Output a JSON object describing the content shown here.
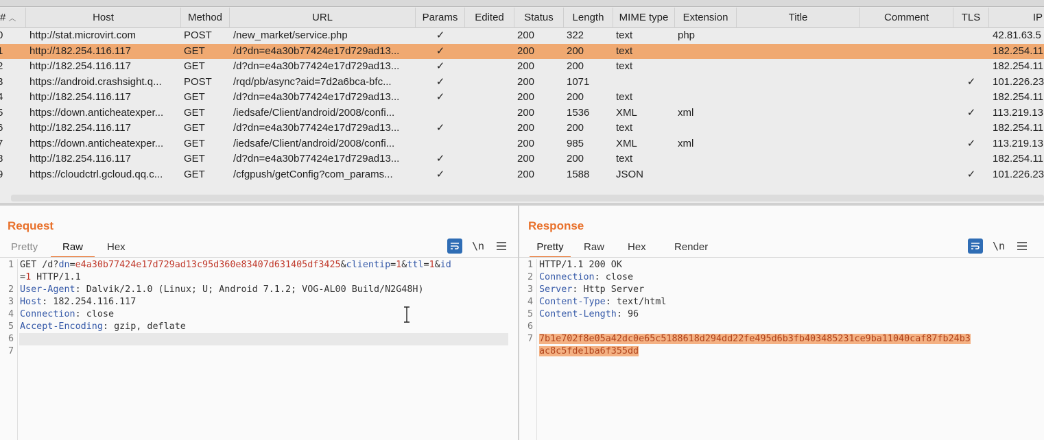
{
  "columns": [
    "#",
    "Host",
    "Method",
    "URL",
    "Params",
    "Edited",
    "Status",
    "Length",
    "MIME type",
    "Extension",
    "Title",
    "Comment",
    "TLS",
    "IP"
  ],
  "sort_icon": "chevron-up-icon",
  "rows": [
    {
      "num": "0",
      "host": "http://stat.microvirt.com",
      "method": "POST",
      "url": "/new_market/service.php",
      "params": "✓",
      "edited": "",
      "status": "200",
      "length": "322",
      "mime": "text",
      "ext": "php",
      "title": "",
      "comment": "",
      "tls": "",
      "ip": "42.81.63.5"
    },
    {
      "num": "1",
      "host": "http://182.254.116.117",
      "method": "GET",
      "url": "/d?dn=e4a30b77424e17d729ad13...",
      "params": "✓",
      "edited": "",
      "status": "200",
      "length": "200",
      "mime": "text",
      "ext": "",
      "title": "",
      "comment": "",
      "tls": "",
      "ip": "182.254.11"
    },
    {
      "num": "2",
      "host": "http://182.254.116.117",
      "method": "GET",
      "url": "/d?dn=e4a30b77424e17d729ad13...",
      "params": "✓",
      "edited": "",
      "status": "200",
      "length": "200",
      "mime": "text",
      "ext": "",
      "title": "",
      "comment": "",
      "tls": "",
      "ip": "182.254.11"
    },
    {
      "num": "3",
      "host": "https://android.crashsight.q...",
      "method": "POST",
      "url": "/rqd/pb/async?aid=7d2a6bca-bfc...",
      "params": "✓",
      "edited": "",
      "status": "200",
      "length": "1071",
      "mime": "",
      "ext": "",
      "title": "",
      "comment": "",
      "tls": "✓",
      "ip": "101.226.23"
    },
    {
      "num": "4",
      "host": "http://182.254.116.117",
      "method": "GET",
      "url": "/d?dn=e4a30b77424e17d729ad13...",
      "params": "✓",
      "edited": "",
      "status": "200",
      "length": "200",
      "mime": "text",
      "ext": "",
      "title": "",
      "comment": "",
      "tls": "",
      "ip": "182.254.11"
    },
    {
      "num": "5",
      "host": "https://down.anticheatexper...",
      "method": "GET",
      "url": "/iedsafe/Client/android/2008/confi...",
      "params": "",
      "edited": "",
      "status": "200",
      "length": "1536",
      "mime": "XML",
      "ext": "xml",
      "title": "",
      "comment": "",
      "tls": "✓",
      "ip": "113.219.13"
    },
    {
      "num": "6",
      "host": "http://182.254.116.117",
      "method": "GET",
      "url": "/d?dn=e4a30b77424e17d729ad13...",
      "params": "✓",
      "edited": "",
      "status": "200",
      "length": "200",
      "mime": "text",
      "ext": "",
      "title": "",
      "comment": "",
      "tls": "",
      "ip": "182.254.11"
    },
    {
      "num": "7",
      "host": "https://down.anticheatexper...",
      "method": "GET",
      "url": "/iedsafe/Client/android/2008/confi...",
      "params": "",
      "edited": "",
      "status": "200",
      "length": "985",
      "mime": "XML",
      "ext": "xml",
      "title": "",
      "comment": "",
      "tls": "✓",
      "ip": "113.219.13"
    },
    {
      "num": "8",
      "host": "http://182.254.116.117",
      "method": "GET",
      "url": "/d?dn=e4a30b77424e17d729ad13...",
      "params": "✓",
      "edited": "",
      "status": "200",
      "length": "200",
      "mime": "text",
      "ext": "",
      "title": "",
      "comment": "",
      "tls": "",
      "ip": "182.254.11"
    },
    {
      "num": "9",
      "host": "https://cloudctrl.gcloud.qq.c...",
      "method": "GET",
      "url": "/cfgpush/getConfig?com_params...",
      "params": "✓",
      "edited": "",
      "status": "200",
      "length": "1588",
      "mime": "JSON",
      "ext": "",
      "title": "",
      "comment": "",
      "tls": "✓",
      "ip": "101.226.23"
    }
  ],
  "selected_row_index": 1,
  "colors": {
    "accent": "#e8702a",
    "selected_row": "#f0a971",
    "toggle_active": "#2f6db5"
  },
  "request": {
    "title": "Request",
    "tabs": [
      "Pretty",
      "Raw",
      "Hex"
    ],
    "active_tab": "Raw",
    "icons": {
      "wrap": "wrap-lines-icon",
      "newline": "\\n",
      "menu": "hamburger-menu-icon"
    },
    "line_numbers": [
      "1",
      "",
      "2",
      "3",
      "4",
      "5",
      "6",
      "7"
    ],
    "line1_method": "GET ",
    "line1_path": "/d?",
    "line1_dn_key": "dn",
    "line1_dn_val": "e4a30b77424e17d729ad13c95d360e83407d631405df3425",
    "line1_amp1": "&",
    "line1_clientip_key": "clientip",
    "line1_clientip_val": "1",
    "line1_amp2": "&",
    "line1_ttl_key": "ttl",
    "line1_ttl_val": "1",
    "line1_amp3": "&",
    "line1_id_key": "id",
    "line1_cont_val": "1",
    "line1_proto": " HTTP/1.1",
    "headers": [
      {
        "name": "User-Agent",
        "value": "Dalvik/2.1.0 (Linux; U; Android 7.1.2; VOG-AL00 Build/N2G48H)"
      },
      {
        "name": "Host",
        "value": "182.254.116.117"
      },
      {
        "name": "Connection",
        "value": "close"
      },
      {
        "name": "Accept-Encoding",
        "value": "gzip, deflate"
      }
    ]
  },
  "response": {
    "title": "Response",
    "tabs": [
      "Pretty",
      "Raw",
      "Hex",
      "Render"
    ],
    "active_tab": "Pretty",
    "icons": {
      "wrap": "wrap-lines-icon",
      "newline": "\\n",
      "menu": "hamburger-menu-icon"
    },
    "line_numbers": [
      "1",
      "2",
      "3",
      "4",
      "5",
      "6",
      "7",
      ""
    ],
    "status_line": "HTTP/1.1 200 OK",
    "headers": [
      {
        "name": "Connection",
        "value": "close"
      },
      {
        "name": "Server",
        "value": "Http Server"
      },
      {
        "name": "Content-Type",
        "value": "text/html"
      },
      {
        "name": "Content-Length",
        "value": "96"
      }
    ],
    "body_line1": "7b1e702f8e05a42dc0e65c5188618d294dd22fe495d6b3fb403485231ce9ba11040caf87fb24b3",
    "body_line2": "ac8c5fde1ba6f355dd"
  },
  "view_switch": [
    "split-horizontal-icon",
    "split-vertical-icon",
    "tabs-view-icon"
  ],
  "cursor": "text-cursor-icon"
}
